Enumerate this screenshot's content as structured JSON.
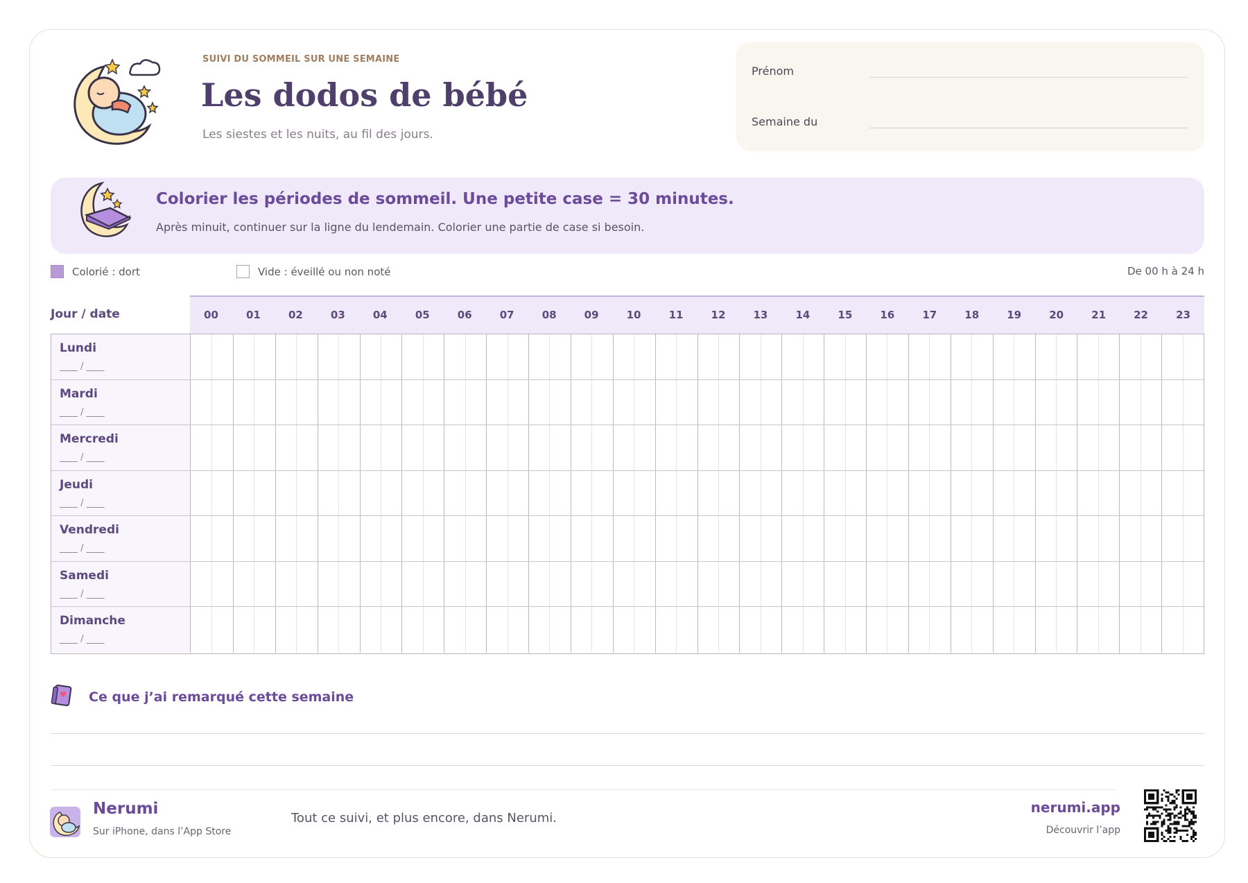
{
  "header": {
    "eyebrow": "SUIVI DU SOMMEIL SUR UNE SEMAINE",
    "title": "Les dodos de bébé",
    "subtitle": "Les siestes et les nuits, au fil des jours."
  },
  "info_card": {
    "name_label": "Prénom",
    "week_label": "Semaine du"
  },
  "banner": {
    "title": "Colorier les périodes de sommeil. Une petite case = 30 minutes.",
    "subtitle": "Après minuit, continuer sur la ligne du lendemain. Colorier une partie de case si besoin."
  },
  "legend": {
    "filled": "Colorié : dort",
    "empty": "Vide : éveillé ou non noté",
    "range": "De 00 h à 24 h"
  },
  "grid": {
    "day_header": "Jour / date",
    "date_placeholder": "____ / ____",
    "hours": [
      "00",
      "01",
      "02",
      "03",
      "04",
      "05",
      "06",
      "07",
      "08",
      "09",
      "10",
      "11",
      "12",
      "13",
      "14",
      "15",
      "16",
      "17",
      "18",
      "19",
      "20",
      "21",
      "22",
      "23"
    ],
    "days": [
      "Lundi",
      "Mardi",
      "Mercredi",
      "Jeudi",
      "Vendredi",
      "Samedi",
      "Dimanche"
    ]
  },
  "notes": {
    "title": "Ce que j’ai remarqué cette semaine"
  },
  "footer": {
    "brand": "Nerumi",
    "brand_sub": "Sur iPhone, dans l’App Store",
    "tagline": "Tout ce suivi, et plus encore, dans Nerumi.",
    "site": "nerumi.app",
    "site_sub": "Découvrir l’app"
  },
  "colors": {
    "accent": "#6b4b9a",
    "lavender": "#efe9f9",
    "cream": "#f9f6f0"
  }
}
